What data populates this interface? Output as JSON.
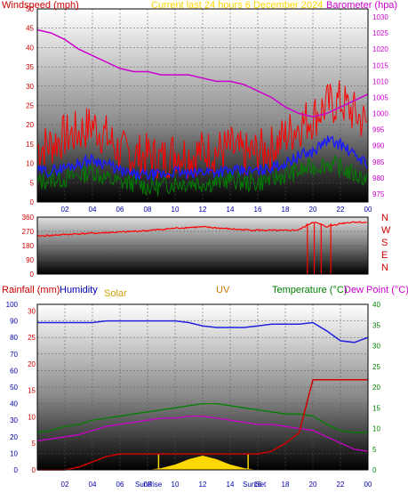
{
  "colors": {
    "wind": "#ff0000",
    "avg_wind": "#1a1aff",
    "wind_low": "#008000",
    "barometer": "#cc00cc",
    "direction": "#ff0000",
    "rain": "#cc0000",
    "humidity": "#0000aa",
    "solar": "#ffd700",
    "uv": "#cc7a00",
    "temperature": "#008000",
    "dewpoint": "#cc00cc",
    "title": "#ffd700"
  },
  "chart_data": [
    {
      "type": "line",
      "title": "Current last 24 hours 6 December 2024",
      "ylabel": "Windspeed (mph)",
      "y2label": "Barometer (hpa)",
      "xticks": [
        "02",
        "04",
        "06",
        "08",
        "10",
        "12",
        "14",
        "16",
        "18",
        "20",
        "22",
        "00"
      ],
      "yticks": [
        "0",
        "5",
        "10",
        "15",
        "20",
        "25",
        "30",
        "35",
        "40",
        "45",
        "50"
      ],
      "y2ticks": [
        "975",
        "980",
        "985",
        "990",
        "995",
        "1000",
        "1005",
        "1010",
        "1015",
        "1020",
        "1025",
        "1030"
      ],
      "ylim": [
        0,
        50
      ],
      "y2lim": [
        972.5,
        1032.5
      ],
      "x": [
        0,
        1,
        2,
        3,
        4,
        5,
        6,
        7,
        8,
        9,
        10,
        11,
        12,
        13,
        14,
        15,
        16,
        17,
        18,
        19,
        20,
        21,
        22,
        23,
        24
      ],
      "series": [
        {
          "name": "Windspeed (mph)",
          "axis": "y",
          "values": [
            14,
            15,
            17,
            18,
            20,
            17,
            13,
            12,
            12,
            11,
            13,
            12,
            13,
            13,
            14,
            12,
            13,
            14,
            17,
            20,
            22,
            25,
            26,
            23,
            20
          ]
        },
        {
          "name": "",
          "axis": "y",
          "values": [
            8,
            8,
            9,
            10,
            11,
            10,
            8,
            7,
            7,
            7,
            8,
            7,
            8,
            8,
            8,
            8,
            8,
            9,
            10,
            12,
            13,
            16,
            15,
            12,
            10
          ]
        },
        {
          "name": "",
          "axis": "y",
          "values": [
            5,
            6,
            6,
            7,
            8,
            6,
            5,
            5,
            4,
            4,
            5,
            5,
            5,
            5,
            6,
            5,
            5,
            6,
            7,
            8,
            9,
            10,
            9,
            7,
            6
          ]
        },
        {
          "name": "Barometer (hpa)",
          "axis": "y2",
          "values": [
            1026,
            1025,
            1023,
            1020,
            1018,
            1016,
            1014,
            1013,
            1013,
            1012,
            1012,
            1012,
            1011,
            1010,
            1010,
            1009,
            1007,
            1005,
            1002,
            1000,
            999,
            1000,
            1002,
            1004,
            1006
          ]
        }
      ]
    },
    {
      "type": "line",
      "title": "",
      "y2label": "N W S E N",
      "xticks": [],
      "yticks": [
        "0",
        "90",
        "180",
        "270",
        "360"
      ],
      "ylim": [
        0,
        360
      ],
      "x": [
        0,
        1,
        2,
        3,
        4,
        5,
        6,
        7,
        8,
        9,
        10,
        11,
        12,
        13,
        14,
        15,
        16,
        17,
        18,
        19,
        20,
        21,
        22,
        23,
        24
      ],
      "series": [
        {
          "name": "",
          "values": [
            240,
            245,
            250,
            255,
            258,
            262,
            265,
            270,
            275,
            282,
            290,
            295,
            298,
            292,
            285,
            280,
            278,
            276,
            275,
            280,
            330,
            300,
            320,
            330,
            325
          ]
        }
      ]
    },
    {
      "type": "line",
      "title": "",
      "ylabel": "Rainfall (mm)",
      "ylabels": [
        "Rainfall (mm)",
        "Humidity",
        "Solar",
        "UV",
        "Temperature (°C)",
        "Dew Point (°C)"
      ],
      "xticks": [
        "02",
        "04",
        "06",
        "08",
        "10",
        "12",
        "14",
        "16",
        "18",
        "20",
        "22",
        "00"
      ],
      "sun_labels": [
        "SunRise",
        "SunSet"
      ],
      "left_ticks_pct": [
        "0",
        "10",
        "20",
        "30",
        "40",
        "50",
        "60",
        "70",
        "80",
        "90",
        "100"
      ],
      "left_ticks_rain": [
        "0",
        "5",
        "10",
        "15",
        "20",
        "25",
        "30"
      ],
      "right_ticks_temp": [
        "0",
        "5",
        "10",
        "15",
        "20",
        "25",
        "30",
        "35",
        "40"
      ],
      "humidity_lim": [
        0,
        100
      ],
      "rain_lim": [
        0,
        31.25
      ],
      "temp_lim": [
        0,
        40
      ],
      "x": [
        0,
        1,
        2,
        3,
        4,
        5,
        6,
        7,
        8,
        9,
        10,
        11,
        12,
        13,
        14,
        15,
        16,
        17,
        18,
        19,
        20,
        21,
        22,
        23,
        24
      ],
      "series": [
        {
          "name": "Humidity",
          "axis": "humidity",
          "values": [
            89,
            89,
            89,
            89,
            89,
            90,
            90,
            90,
            90,
            90,
            90,
            89,
            87,
            86,
            86,
            86,
            87,
            88,
            88,
            88,
            89,
            84,
            78,
            77,
            80
          ]
        },
        {
          "name": "Rainfall (mm)",
          "axis": "rain",
          "values": [
            0,
            0,
            0,
            0.5,
            1.5,
            2.5,
            3,
            3,
            3,
            3,
            3,
            3,
            3,
            3,
            3,
            3,
            3,
            3.5,
            5,
            7,
            17,
            17,
            17,
            17,
            17
          ]
        },
        {
          "name": "Temperature (°C)",
          "axis": "temp",
          "values": [
            9,
            9.5,
            10.5,
            11,
            12,
            12.5,
            13,
            13.5,
            14,
            14.5,
            15,
            15.5,
            16,
            16,
            15.5,
            15,
            14.5,
            14,
            13.5,
            13.5,
            13,
            11,
            9.5,
            9,
            9
          ]
        },
        {
          "name": "Dew Point (°C)",
          "axis": "temp",
          "values": [
            7,
            7.5,
            8,
            8.5,
            9.5,
            10.5,
            11,
            11.5,
            12,
            12.5,
            12.5,
            13,
            13,
            12.5,
            12,
            11.5,
            11,
            11,
            10.5,
            10,
            9.5,
            8,
            6.5,
            5,
            4.5
          ]
        },
        {
          "name": "Solar",
          "axis": "solar",
          "values": [
            0,
            0,
            0,
            0,
            0,
            0,
            0,
            0,
            0,
            1,
            3,
            6,
            8,
            6,
            3,
            1,
            0,
            0,
            0,
            0,
            0,
            0,
            0,
            0,
            0
          ]
        },
        {
          "name": "UV",
          "axis": "solar",
          "values": [
            0,
            0,
            0,
            0,
            0,
            0,
            0,
            0,
            0,
            0,
            0,
            0,
            0,
            0,
            0,
            0,
            0,
            0,
            0,
            0,
            0,
            0,
            0,
            0,
            0
          ]
        }
      ]
    }
  ]
}
